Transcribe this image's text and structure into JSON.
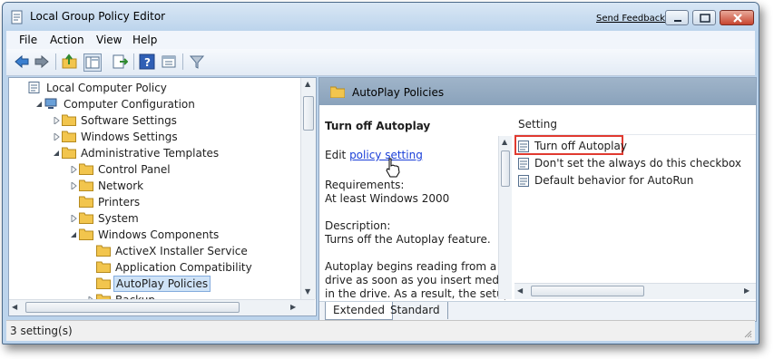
{
  "window": {
    "title": "Local Group Policy Editor",
    "feedback_link": "Send Feedback"
  },
  "menu": [
    "File",
    "Action",
    "View",
    "Help"
  ],
  "toolbar": [
    "back-icon",
    "forward-icon",
    "up-folder-icon",
    "show-hide-tree-icon",
    "export-list-icon",
    "help-icon",
    "properties-icon",
    "filter-icon"
  ],
  "tree": {
    "items": [
      {
        "label": "Local Computer Policy",
        "level": 0,
        "expander": "none",
        "icon": "policy-icon"
      },
      {
        "label": "Computer Configuration",
        "level": 1,
        "expander": "expanded",
        "icon": "computer-icon"
      },
      {
        "label": "Software Settings",
        "level": 2,
        "expander": "collapsed",
        "icon": "folder-icon"
      },
      {
        "label": "Windows Settings",
        "level": 2,
        "expander": "collapsed",
        "icon": "folder-icon"
      },
      {
        "label": "Administrative Templates",
        "level": 2,
        "expander": "expanded",
        "icon": "folder-icon"
      },
      {
        "label": "Control Panel",
        "level": 3,
        "expander": "collapsed",
        "icon": "folder-icon"
      },
      {
        "label": "Network",
        "level": 3,
        "expander": "collapsed",
        "icon": "folder-icon"
      },
      {
        "label": "Printers",
        "level": 3,
        "expander": "none",
        "icon": "folder-icon"
      },
      {
        "label": "System",
        "level": 3,
        "expander": "collapsed",
        "icon": "folder-icon"
      },
      {
        "label": "Windows Components",
        "level": 3,
        "expander": "expanded",
        "icon": "folder-icon"
      },
      {
        "label": "ActiveX Installer Service",
        "level": 4,
        "expander": "none",
        "icon": "folder-icon"
      },
      {
        "label": "Application Compatibility",
        "level": 4,
        "expander": "none",
        "icon": "folder-icon"
      },
      {
        "label": "AutoPlay Policies",
        "level": 4,
        "expander": "none",
        "icon": "folder-icon",
        "selected": true
      },
      {
        "label": "Backup",
        "level": 4,
        "expander": "collapsed",
        "icon": "folder-icon"
      }
    ]
  },
  "detail": {
    "header_title": "AutoPlay Policies",
    "heading": "Turn off Autoplay",
    "edit_prefix": "Edit ",
    "edit_link": "policy setting",
    "lines": [
      "Requirements:",
      "At least Windows 2000",
      "Description:",
      "Turns off the Autoplay feature.",
      "Autoplay begins reading from a",
      "drive as soon as you insert media",
      "in the drive. As a result, the setup"
    ]
  },
  "list": {
    "column": "Setting",
    "items": [
      {
        "label": "Turn off Autoplay",
        "highlighted": true
      },
      {
        "label": "Don't set the always do this checkbox"
      },
      {
        "label": "Default behavior for AutoRun"
      }
    ]
  },
  "tabs": [
    "Extended",
    "Standard"
  ],
  "status": "3 setting(s)",
  "colors": {
    "highlight_frame": "#e03a30",
    "link": "#1a3fd8",
    "header_band": "#8aa2bb"
  }
}
